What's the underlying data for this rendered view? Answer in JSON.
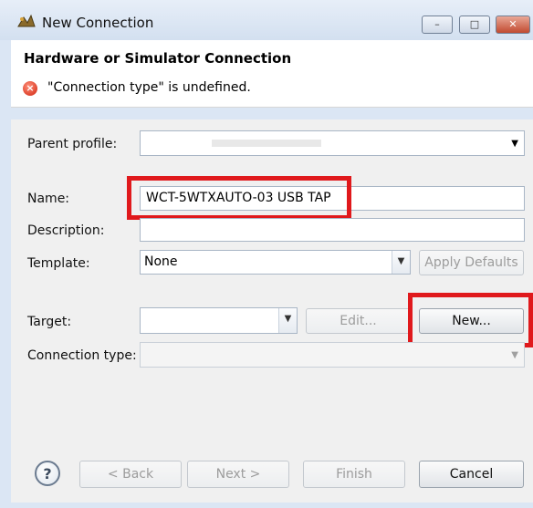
{
  "window": {
    "title": "New Connection",
    "controls": {
      "minimize": "–",
      "maximize": "□",
      "close": "✕"
    }
  },
  "header": {
    "title": "Hardware or Simulator Connection",
    "error_icon": "x-circle-icon",
    "error_glyph": "×",
    "error_message": "\"Connection type\" is undefined."
  },
  "form": {
    "parent_profile_label": "Parent profile:",
    "parent_profile_value": "",
    "name_label": "Name:",
    "name_value": "WCT-5WTXAUTO-03 USB TAP",
    "description_label": "Description:",
    "description_value": "",
    "template_label": "Template:",
    "template_value": "None",
    "apply_defaults_label": "Apply Defaults",
    "target_label": "Target:",
    "target_value": "",
    "edit_label": "Edit...",
    "new_label": "New...",
    "connection_type_label": "Connection type:",
    "connection_type_value": ""
  },
  "footer": {
    "help_icon": "help-icon",
    "help_glyph": "?",
    "back_label": "< Back",
    "next_label": "Next >",
    "finish_label": "Finish",
    "cancel_label": "Cancel"
  },
  "colors": {
    "highlight": "#e0191c",
    "error": "#d0230d"
  }
}
